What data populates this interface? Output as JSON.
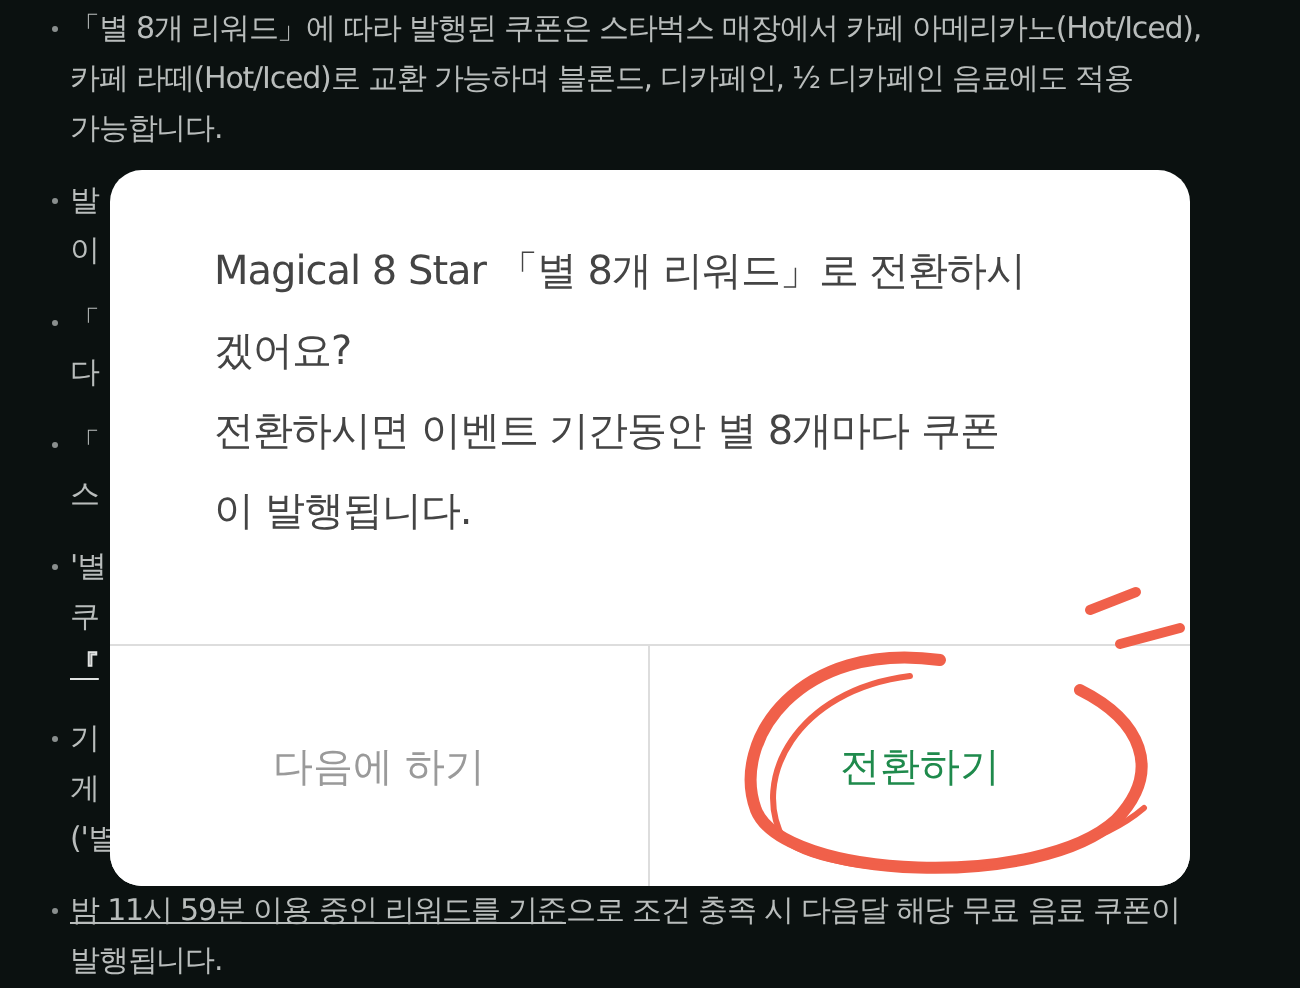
{
  "notice_items": [
    {
      "lines": [
        {
          "text": "「별 8개 리워드」에 따라 발행된 쿠폰은 스타벅스 매장에서 카페 아메리카노(Hot/Iced),",
          "kind": "plain"
        },
        {
          "text": "카페 라떼(Hot/Iced)로 교환 가능하며 블론드, 디카페인, ½ 디카페인 음료에도 적용",
          "kind": "plain"
        },
        {
          "text": "가능합니다.",
          "kind": "plain"
        }
      ]
    },
    {
      "lines": [
        {
          "text": "발",
          "kind": "plain"
        },
        {
          "text": "이",
          "kind": "plain"
        }
      ]
    },
    {
      "lines": [
        {
          "text": "「",
          "kind": "plain"
        },
        {
          "text": "다",
          "kind": "plain"
        }
      ]
    },
    {
      "lines": [
        {
          "text": "「",
          "kind": "plain"
        },
        {
          "text": "스",
          "kind": "plain"
        }
      ]
    },
    {
      "lines": [
        {
          "text": "'별",
          "kind": "plain"
        },
        {
          "text": "쿠",
          "kind": "plain"
        },
        {
          "text": "『",
          "kind": "strong"
        }
      ]
    },
    {
      "lines": [
        {
          "text": "기",
          "kind": "plain"
        },
        {
          "text": "게",
          "kind": "plain"
        },
        {
          "text": "('별",
          "kind": "plain"
        }
      ]
    },
    {
      "lines": [
        {
          "text": "밤 11시 59분 이용 중인 리워드를 기준",
          "kind": "underlined"
        },
        {
          "text": "으로 조건 충족 시 다음달 해당 무료 음료 쿠폰이",
          "kind": "continued"
        },
        {
          "text": "발행됩니다.",
          "kind": "plain"
        }
      ]
    }
  ],
  "dialog": {
    "message_lines": [
      "Magical 8 Star 「별 8개 리워드」로 전환하시",
      "겠어요?",
      "전환하시면 이벤트 기간동안 별 8개마다 쿠폰",
      "이 발행됩니다."
    ],
    "buttons": [
      {
        "label": "다음에 하기",
        "kind": "secondary"
      },
      {
        "label": "전환하기",
        "kind": "primary"
      }
    ]
  }
}
